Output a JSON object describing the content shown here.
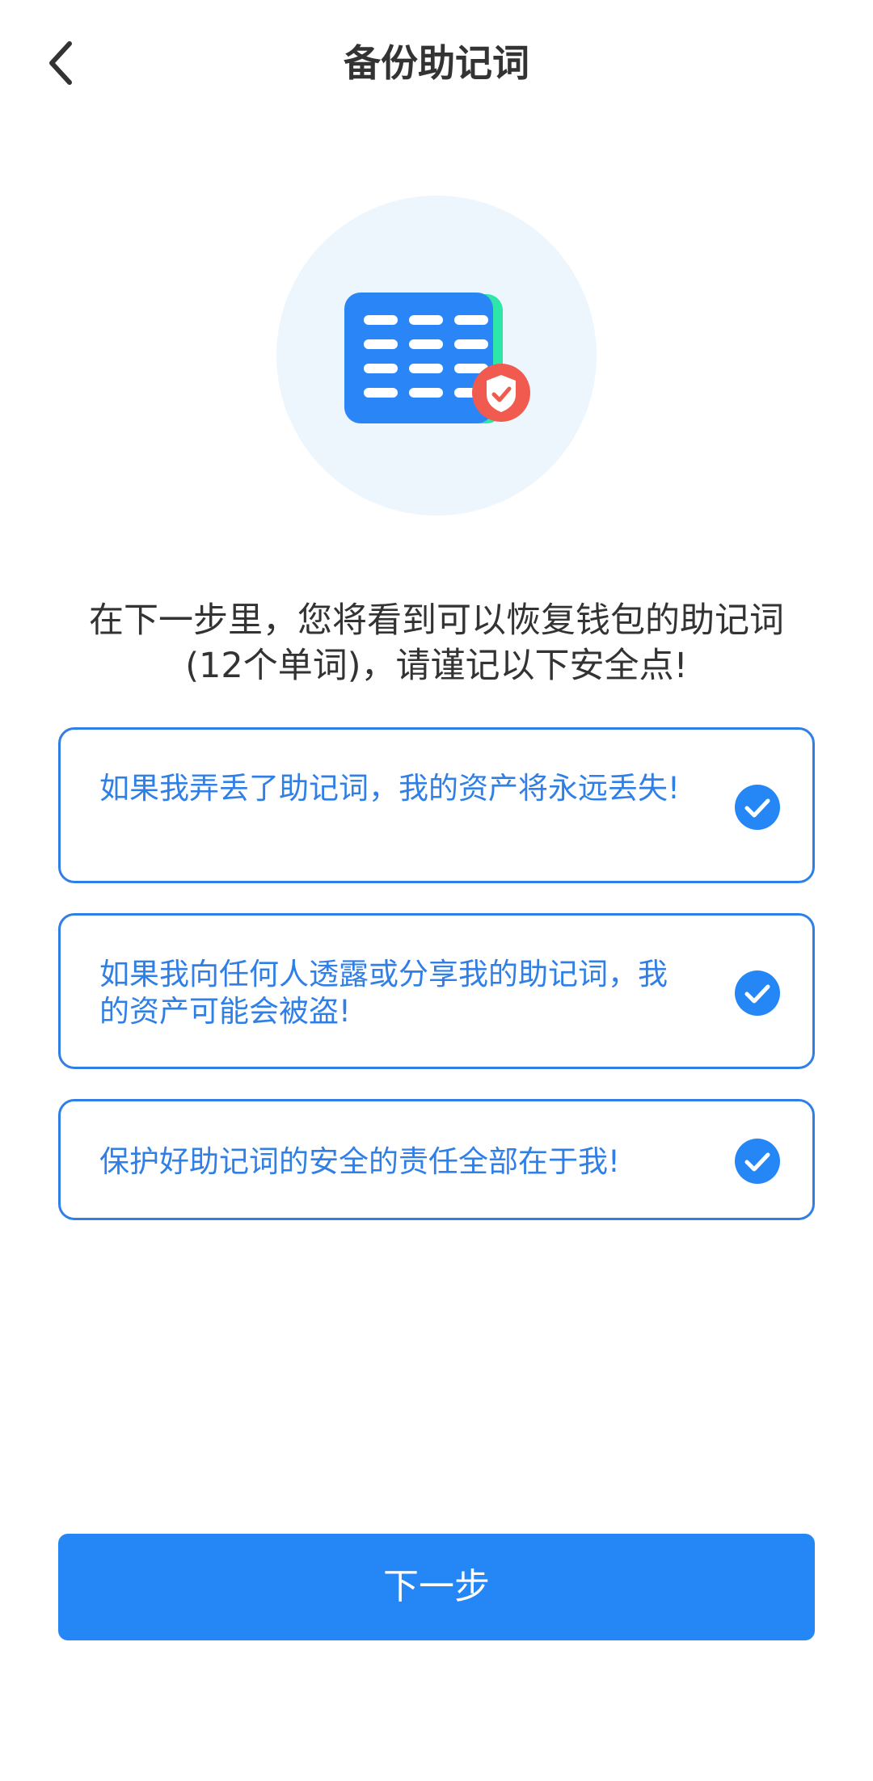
{
  "header": {
    "title": "备份助记词",
    "back_icon": "chevron-left-icon"
  },
  "illustration": {
    "icon": "mnemonic-card-shield-icon",
    "colors": {
      "circle": "#eef6fd",
      "card": "#2a86f6",
      "accent": "#2ee6a8",
      "shield": "#f05a4f"
    }
  },
  "intro": {
    "line1": "在下一步里，您将看到可以恢复钱包的助记词",
    "line2": "(12个单词)，请谨记以下安全点!"
  },
  "checklist": [
    {
      "text": "如果我弄丢了助记词，我的资产将永远丢失!",
      "checked": true
    },
    {
      "text": "如果我向任何人透露或分享我的助记词，我的资产可能会被盗!",
      "checked": true
    },
    {
      "text": "保护好助记词的安全的责任全部在于我!",
      "checked": true
    }
  ],
  "footer": {
    "next_label": "下一步"
  },
  "colors": {
    "primary": "#2586f5",
    "card_text": "#2f7fe6",
    "title": "#333333"
  }
}
